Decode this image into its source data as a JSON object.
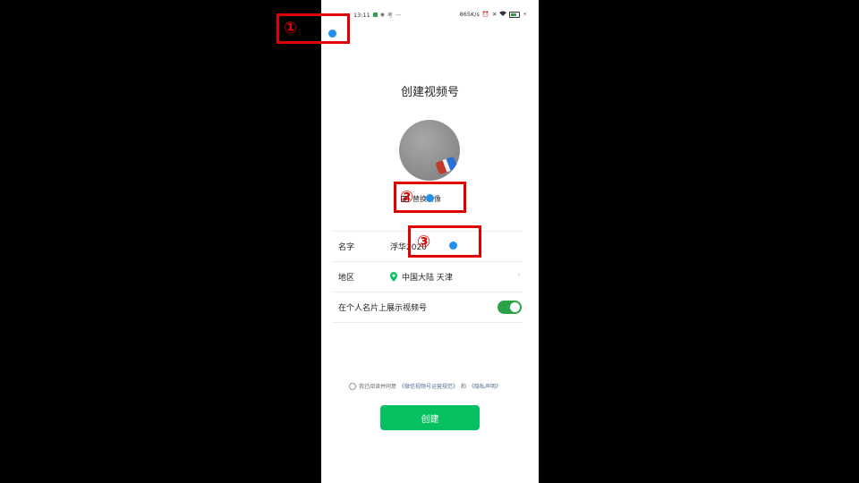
{
  "status_bar": {
    "time": "13:11",
    "left_icons": [
      "wechat-notify-icon",
      "app-icon",
      "app-icon-2"
    ],
    "more": "···",
    "net_speed": "865K/s",
    "right_icons": [
      "alarm-icon",
      "mute-icon",
      "wifi-icon",
      "battery-icon",
      "charging-icon"
    ]
  },
  "page": {
    "title": "创建视频号"
  },
  "avatar": {
    "change_label": "替换头像"
  },
  "form": {
    "name_label": "名字",
    "name_value": "浮华2020",
    "region_label": "地区",
    "region_value": "中国大陆 天津",
    "show_label": "在个人名片上展示视频号",
    "show_enabled": true
  },
  "agreement": {
    "prefix": "我已阅读并同意",
    "link1": "《微信视频号运营规范》",
    "mid": "和",
    "link2": "《隐私声明》"
  },
  "actions": {
    "create_label": "创建"
  },
  "annotations": {
    "step1": "①",
    "step2": "②",
    "step3": "③",
    "border_color": "#e00000",
    "tap_color": "#1f8ff0"
  },
  "colors": {
    "accent_green": "#07c160",
    "link_blue": "#576b95"
  }
}
